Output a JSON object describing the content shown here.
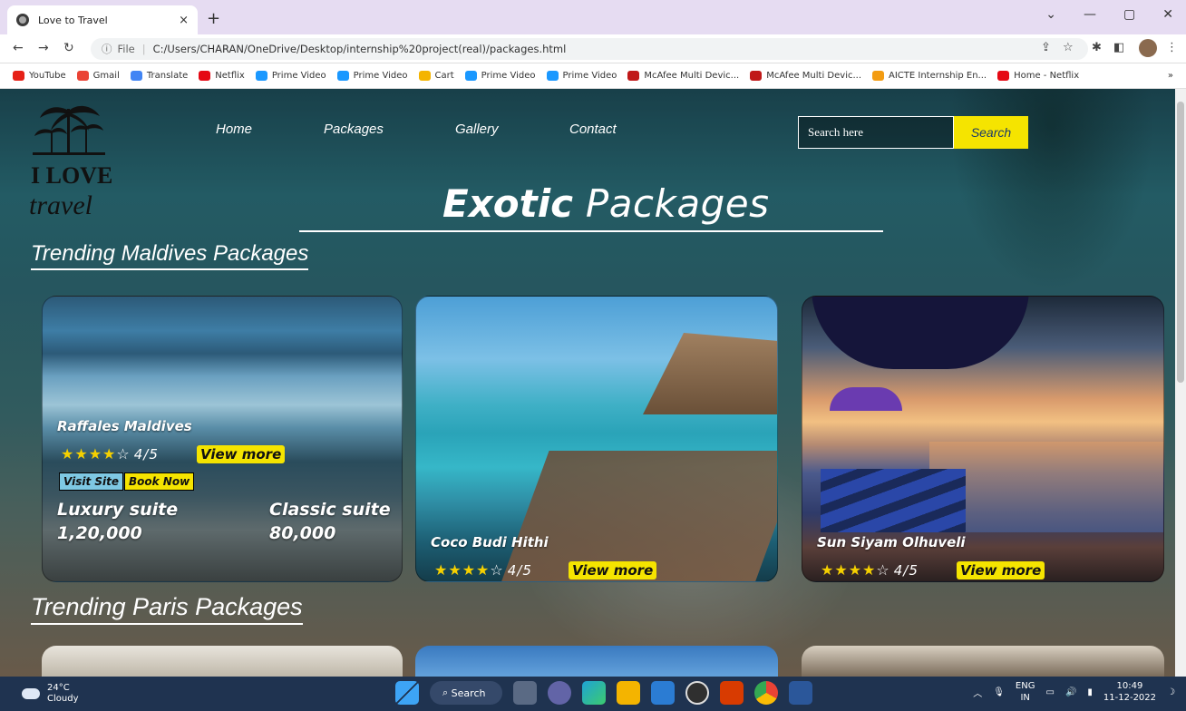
{
  "browser": {
    "tab_title": "Love to Travel",
    "tab_close": "×",
    "new_tab": "+",
    "url_prefix": "File",
    "url": "C:/Users/CHARAN/OneDrive/Desktop/internship%20project(real)/packages.html",
    "bookmarks": [
      {
        "label": "YouTube",
        "color": "#e62117"
      },
      {
        "label": "Gmail",
        "color": "#ea4335"
      },
      {
        "label": "Translate",
        "color": "#4285f4"
      },
      {
        "label": "Netflix",
        "color": "#e50914"
      },
      {
        "label": "Prime Video",
        "color": "#1a98ff"
      },
      {
        "label": "Prime Video",
        "color": "#1a98ff"
      },
      {
        "label": "Cart",
        "color": "#f4b400"
      },
      {
        "label": "Prime Video",
        "color": "#1a98ff"
      },
      {
        "label": "Prime Video",
        "color": "#1a98ff"
      },
      {
        "label": "McAfee Multi Devic...",
        "color": "#c01818"
      },
      {
        "label": "McAfee Multi Devic...",
        "color": "#c01818"
      },
      {
        "label": "AICTE Internship En...",
        "color": "#f39c12"
      },
      {
        "label": "Home - Netflix",
        "color": "#e50914"
      }
    ],
    "bookmarks_more": "»"
  },
  "nav": {
    "links": [
      "Home",
      "Packages",
      "Gallery",
      "Contact"
    ],
    "search_placeholder": "Search here",
    "search_button": "Search"
  },
  "logo": {
    "line1": "I LOVE",
    "line2": "travel"
  },
  "hero": {
    "bold": "Exotic",
    "rest": " Packages"
  },
  "sections": {
    "maldives_title": "Trending Maldives Packages",
    "paris_title": "Trending Paris Packages"
  },
  "cards": [
    {
      "name": "Raffales Maldives",
      "rating": "4/5",
      "stars_filled": 4,
      "stars_total": 5,
      "view_more": "View more",
      "visit_site": "Visit Site",
      "book_now": "Book Now",
      "suite1_name": "Luxury suite",
      "suite1_price": "1,20,000",
      "suite2_name": "Classic suite",
      "suite2_price": "80,000"
    },
    {
      "name": "Coco Budi Hithi",
      "rating": "4/5",
      "stars_filled": 4,
      "stars_total": 5,
      "view_more": "View more"
    },
    {
      "name": "Sun Siyam Olhuveli",
      "rating": "4/5",
      "stars_filled": 4,
      "stars_total": 5,
      "view_more": "View more"
    }
  ],
  "taskbar": {
    "temp": "24°C",
    "weather": "Cloudy",
    "search": "Search",
    "lang1": "ENG",
    "lang2": "IN",
    "time": "10:49",
    "date": "11-12-2022"
  },
  "colors": {
    "accent_yellow": "#f5e400",
    "visit_site_bg": "#7ec8e3",
    "book_now_bg": "#f5e400"
  }
}
